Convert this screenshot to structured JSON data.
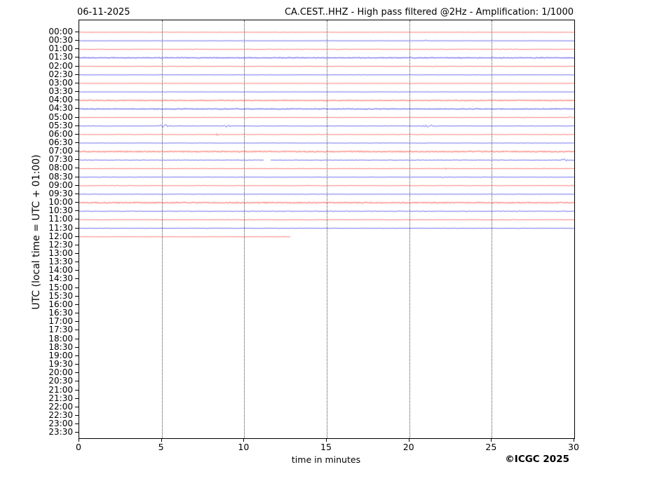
{
  "header": {
    "date": "06-11-2025",
    "title": "CA.CEST..HHZ - High pass filtered @2Hz - Amplification: 1/1000"
  },
  "axes": {
    "ylabel": "UTC (local time = UTC + 01:00)",
    "xlabel": "time in minutes",
    "xticks": [
      "0",
      "5",
      "10",
      "15",
      "20",
      "25",
      "30"
    ],
    "gridlines_minutes": [
      5,
      10,
      15,
      20,
      25
    ]
  },
  "footer": {
    "copyright": "©ICGC 2025"
  },
  "chart_data": {
    "type": "line",
    "title": "CA.CEST..HHZ - High pass filtered @2Hz - Amplification: 1/1000",
    "date": "06-11-2025",
    "xlabel": "time in minutes",
    "ylabel": "UTC (local time = UTC + 01:00)",
    "xlim": [
      0,
      30
    ],
    "grid": "vertical-dotted",
    "legend": "none",
    "colors": {
      "red": "#f7564d",
      "blue": "#4343e8"
    },
    "times": [
      "00:00",
      "00:30",
      "01:00",
      "01:30",
      "02:00",
      "02:30",
      "03:00",
      "03:30",
      "04:00",
      "04:30",
      "05:00",
      "05:30",
      "06:00",
      "06:30",
      "07:00",
      "07:30",
      "08:00",
      "08:30",
      "09:00",
      "09:30",
      "10:00",
      "10:30",
      "11:00",
      "11:30",
      "12:00",
      "12:30",
      "13:00",
      "13:30",
      "14:00",
      "14:30",
      "15:00",
      "15:30",
      "16:00",
      "16:30",
      "17:00",
      "17:30",
      "18:00",
      "18:30",
      "19:00",
      "19:30",
      "20:00",
      "20:30",
      "21:00",
      "21:30",
      "22:00",
      "22:30",
      "23:00",
      "23:30"
    ],
    "traces": [
      {
        "time": "00:00",
        "color": "red",
        "start": 0,
        "end": 30,
        "amp": 0.35,
        "events": []
      },
      {
        "time": "00:30",
        "color": "blue",
        "start": 0,
        "end": 30,
        "amp": 0.35,
        "events": [
          {
            "t": 21.0,
            "a": 1.7,
            "w": 0.15
          }
        ]
      },
      {
        "time": "01:00",
        "color": "red",
        "start": 0,
        "end": 30,
        "amp": 0.6,
        "events": []
      },
      {
        "time": "01:30",
        "color": "blue",
        "start": 0,
        "end": 30,
        "amp": 1.0,
        "events": []
      },
      {
        "time": "02:00",
        "color": "red",
        "start": 0,
        "end": 30,
        "amp": 0.45,
        "events": [
          {
            "t": 21.5,
            "a": 0.7,
            "w": 0.2
          }
        ]
      },
      {
        "time": "02:30",
        "color": "blue",
        "start": 0,
        "end": 30,
        "amp": 0.4,
        "events": []
      },
      {
        "time": "03:00",
        "color": "red",
        "start": 0,
        "end": 30,
        "amp": 0.35,
        "events": []
      },
      {
        "time": "03:30",
        "color": "blue",
        "start": 0,
        "end": 30,
        "amp": 0.35,
        "events": []
      },
      {
        "time": "04:00",
        "color": "red",
        "start": 0,
        "end": 30,
        "amp": 0.95,
        "events": []
      },
      {
        "time": "04:30",
        "color": "blue",
        "start": 0,
        "end": 30,
        "amp": 0.95,
        "events": []
      },
      {
        "time": "05:00",
        "color": "red",
        "start": 0,
        "end": 30,
        "amp": 0.45,
        "events": [
          {
            "t": 10.1,
            "a": 1.1,
            "w": 0.15
          },
          {
            "t": 26.8,
            "a": 0.6,
            "w": 0.8
          },
          {
            "t": 29.7,
            "a": 1.7,
            "w": 0.15
          }
        ]
      },
      {
        "time": "05:30",
        "color": "blue",
        "start": 0,
        "end": 30,
        "amp": 0.5,
        "events": [
          {
            "t": 5.1,
            "a": 1.9,
            "w": 0.35
          },
          {
            "t": 9.0,
            "a": 2.3,
            "w": 0.2
          },
          {
            "t": 21.2,
            "a": 2.3,
            "w": 0.35
          }
        ]
      },
      {
        "time": "06:00",
        "color": "red",
        "start": 0,
        "end": 30,
        "amp": 0.45,
        "events": [
          {
            "t": 8.35,
            "a": 2.2,
            "w": 0.12
          }
        ]
      },
      {
        "time": "06:30",
        "color": "blue",
        "start": 0,
        "end": 30,
        "amp": 0.45,
        "events": []
      },
      {
        "time": "07:00",
        "color": "red",
        "start": 0,
        "end": 30,
        "amp": 1.3,
        "events": []
      },
      {
        "time": "07:30",
        "color": "blue",
        "start": 0,
        "end": 30,
        "amp": 0.55,
        "gaps": [
          [
            11.2,
            11.6
          ]
        ],
        "events": [
          {
            "t": 29.4,
            "a": 1.6,
            "w": 0.25
          }
        ]
      },
      {
        "time": "08:00",
        "color": "red",
        "start": 0,
        "end": 30,
        "amp": 0.45,
        "events": [
          {
            "t": 22.2,
            "a": 1.6,
            "w": 0.12
          }
        ]
      },
      {
        "time": "08:30",
        "color": "blue",
        "start": 0,
        "end": 30,
        "amp": 0.45,
        "events": [
          {
            "t": 22.1,
            "a": 1.1,
            "w": 0.12
          }
        ]
      },
      {
        "time": "09:00",
        "color": "red",
        "start": 0,
        "end": 30,
        "amp": 0.5,
        "events": [
          {
            "t": 29.9,
            "a": 1.6,
            "w": 0.1
          }
        ]
      },
      {
        "time": "09:30",
        "color": "blue",
        "start": 0,
        "end": 30,
        "amp": 0.45,
        "events": []
      },
      {
        "time": "10:00",
        "color": "red",
        "start": 0,
        "end": 30,
        "amp": 1.3,
        "events": []
      },
      {
        "time": "10:30",
        "color": "blue",
        "start": 0,
        "end": 30,
        "amp": 0.8,
        "events": []
      },
      {
        "time": "11:00",
        "color": "red",
        "start": 0,
        "end": 30,
        "amp": 0.5,
        "events": []
      },
      {
        "time": "11:30",
        "color": "blue",
        "start": 0,
        "end": 30,
        "amp": 0.55,
        "events": []
      },
      {
        "time": "12:00",
        "color": "red",
        "start": 0,
        "end": 12.8,
        "amp": 0.45,
        "events": []
      }
    ]
  }
}
